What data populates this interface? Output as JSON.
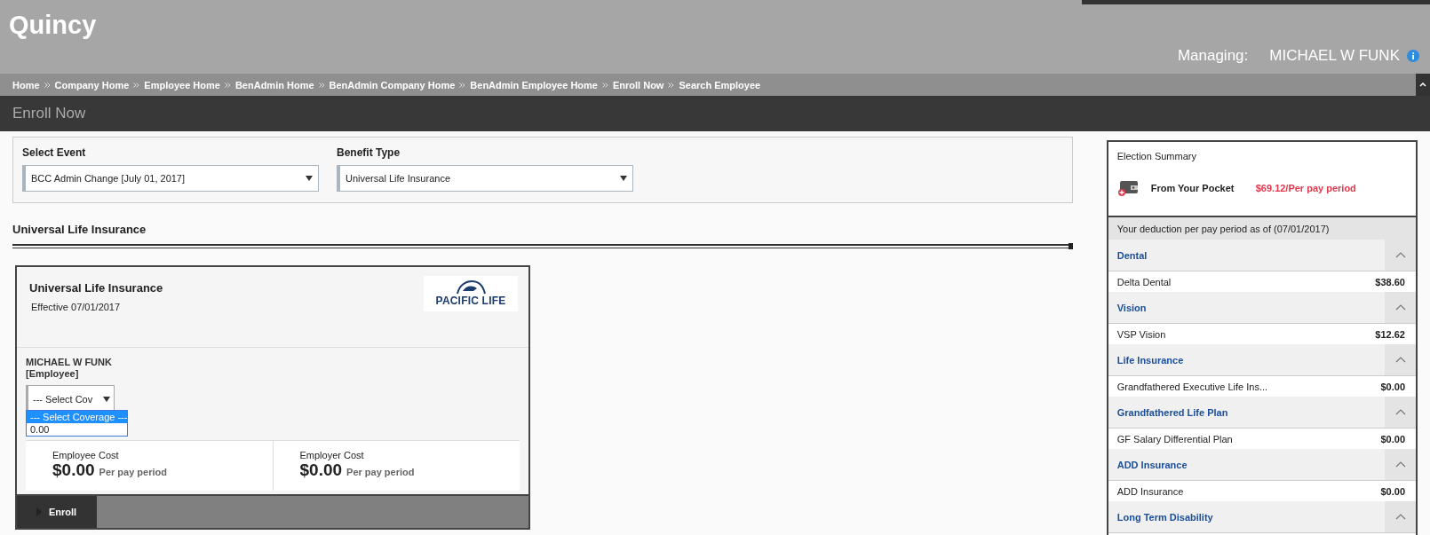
{
  "header": {
    "brand": "Quincy",
    "managing_label": "Managing:",
    "managing_name": "MICHAEL W FUNK"
  },
  "breadcrumbs": [
    "Home",
    "Company Home",
    "Employee Home",
    "BenAdmin Home",
    "BenAdmin Company Home",
    "BenAdmin Employee Home",
    "Enroll Now",
    "Search Employee"
  ],
  "page_title": "Enroll Now",
  "filters": [
    {
      "label": "Select Event",
      "value": "BCC Admin Change [July 01, 2017]"
    },
    {
      "label": "Benefit Type",
      "value": "Universal Life Insurance"
    }
  ],
  "section_title": "Universal Life Insurance",
  "plan_card": {
    "title": "Universal Life Insurance",
    "effective": "Effective 07/01/2017",
    "logo_text": "PACIFIC LIFE",
    "member_name": "MICHAEL W FUNK",
    "member_role": "[Employee]",
    "coverage_select": {
      "value": "--- Select Cov",
      "expanded": true,
      "options": [
        {
          "label": "--- Select Coverage ---",
          "selected": true
        },
        {
          "label": "0.00",
          "selected": false
        }
      ]
    },
    "costs": [
      {
        "label": "Employee Cost",
        "amount": "$0.00",
        "period": "Per pay period"
      },
      {
        "label": "Employer Cost",
        "amount": "$0.00",
        "period": "Per pay period"
      }
    ],
    "enroll_button": "Enroll"
  },
  "election_summary": {
    "title": "Election Summary",
    "pocket_label": "From Your Pocket",
    "pocket_amount": "$69.12/Per pay period",
    "deduction_note": "Your deduction per pay period as of (07/01/2017)",
    "sections": [
      {
        "name": "Dental",
        "expanded": true,
        "items": [
          {
            "name": "Delta Dental",
            "amount": "$38.60"
          }
        ]
      },
      {
        "name": "Vision",
        "expanded": true,
        "items": [
          {
            "name": "VSP Vision",
            "amount": "$12.62"
          }
        ]
      },
      {
        "name": "Life Insurance",
        "expanded": true,
        "items": [
          {
            "name": "Grandfathered Executive Life Ins...",
            "amount": "$0.00"
          }
        ]
      },
      {
        "name": "Grandfathered Life Plan",
        "expanded": true,
        "items": [
          {
            "name": "GF Salary Differential Plan",
            "amount": "$0.00"
          }
        ]
      },
      {
        "name": "ADD Insurance",
        "expanded": true,
        "items": [
          {
            "name": "ADD Insurance",
            "amount": "$0.00"
          }
        ]
      },
      {
        "name": "Long Term Disability",
        "expanded": true
      }
    ]
  }
}
